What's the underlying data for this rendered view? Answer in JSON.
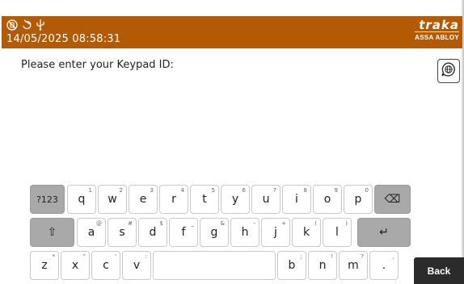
{
  "header": {
    "datetime": "14/05/2025 08:58:31",
    "brand_name": "traka",
    "brand_sub": "ASSA ABLOY",
    "status_icons": [
      "no-network-icon",
      "sync-off-icon",
      "usb-icon"
    ]
  },
  "prompt": "Please enter your Keypad ID:",
  "language_button_icon": "globe-chat-icon",
  "keyboard": {
    "row1": [
      {
        "label": "?123",
        "hint": ""
      },
      {
        "label": "q",
        "hint": "1"
      },
      {
        "label": "w",
        "hint": "2"
      },
      {
        "label": "e",
        "hint": "3"
      },
      {
        "label": "r",
        "hint": "4"
      },
      {
        "label": "t",
        "hint": "5"
      },
      {
        "label": "y",
        "hint": "6"
      },
      {
        "label": "u",
        "hint": "7"
      },
      {
        "label": "i",
        "hint": "8"
      },
      {
        "label": "o",
        "hint": "9"
      },
      {
        "label": "p",
        "hint": "0"
      },
      {
        "label": "⌫",
        "hint": ""
      }
    ],
    "row2": [
      {
        "label": "⇧",
        "hint": ""
      },
      {
        "label": "a",
        "hint": "@"
      },
      {
        "label": "s",
        "hint": "#"
      },
      {
        "label": "d",
        "hint": "$"
      },
      {
        "label": "f",
        "hint": "_"
      },
      {
        "label": "g",
        "hint": "&"
      },
      {
        "label": "h",
        "hint": "-"
      },
      {
        "label": "j",
        "hint": "+"
      },
      {
        "label": "k",
        "hint": "("
      },
      {
        "label": "l",
        "hint": ")"
      },
      {
        "label": "↵",
        "hint": ""
      }
    ],
    "row3": [
      {
        "label": "z",
        "hint": "*"
      },
      {
        "label": "x",
        "hint": "\""
      },
      {
        "label": "c",
        "hint": "'"
      },
      {
        "label": "v",
        "hint": ":"
      },
      {
        "label": "",
        "hint": ""
      },
      {
        "label": "b",
        "hint": ";"
      },
      {
        "label": "n",
        "hint": "!"
      },
      {
        "label": "m",
        "hint": "?"
      },
      {
        "label": ".",
        "hint": ","
      }
    ]
  },
  "back_label": "Back",
  "colors": {
    "header_bg": "#b35b04",
    "key_dark": "#a9a9a9",
    "back_bg": "#2b2b2b"
  }
}
